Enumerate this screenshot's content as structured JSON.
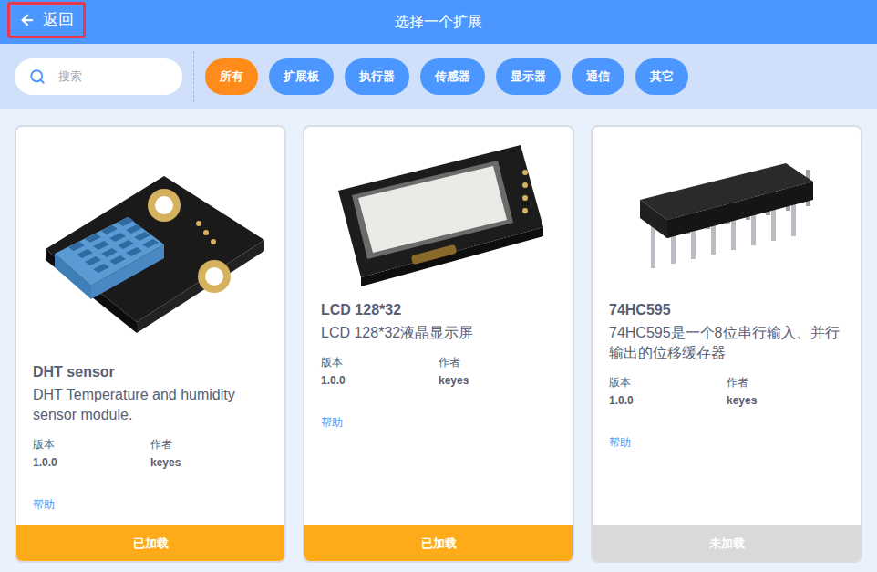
{
  "top_bar": {
    "back_label": "返回",
    "back_highlighted": true,
    "title": "选择一个扩展"
  },
  "search": {
    "placeholder": "搜索"
  },
  "filters": [
    {
      "label": "所有",
      "selected": true
    },
    {
      "label": "扩展板",
      "selected": false
    },
    {
      "label": "执行器",
      "selected": false
    },
    {
      "label": "传感器",
      "selected": false
    },
    {
      "label": "显示器",
      "selected": false
    },
    {
      "label": "通信",
      "selected": false
    },
    {
      "label": "其它",
      "selected": false
    }
  ],
  "cards": [
    {
      "kind": "dht",
      "name": "DHT sensor",
      "description": "DHT Temperature and humidity sensor module.",
      "version_label": "版本",
      "version": "1.0.0",
      "author_label": "作者",
      "author": "keyes",
      "help": "帮助",
      "status": "已加载",
      "loaded": true
    },
    {
      "kind": "lcd",
      "name": "LCD 128*32",
      "description": "LCD 128*32液晶显示屏",
      "version_label": "版本",
      "version": "1.0.0",
      "author_label": "作者",
      "author": "keyes",
      "help": "帮助",
      "status": "已加载",
      "loaded": true
    },
    {
      "kind": "chip",
      "name": "74HC595",
      "description": "74HC595是一个8位串行输入、并行输出的位移缓存器",
      "version_label": "版本",
      "version": "1.0.0",
      "author_label": "作者",
      "author": "keyes",
      "help": "帮助",
      "status": "未加载",
      "loaded": false
    }
  ]
}
